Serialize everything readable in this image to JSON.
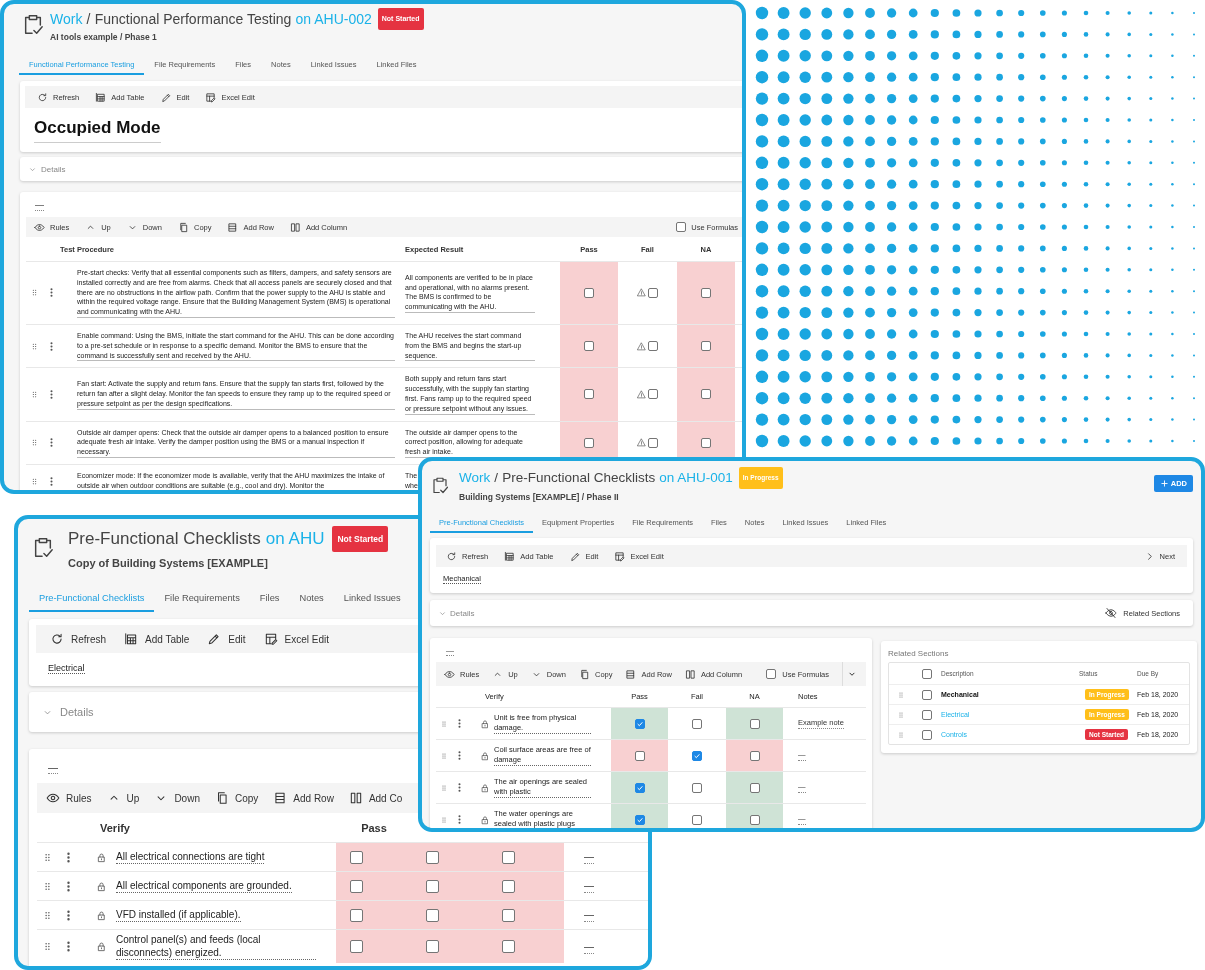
{
  "windows": [
    {
      "title": {
        "parent": "Work",
        "separator": "/",
        "name": "Functional Performance Testing",
        "target": "on AHU-002"
      },
      "badge": {
        "text": "Not Started",
        "kind": "danger"
      },
      "subtitle": "AI tools example / Phase 1",
      "tabs": [
        {
          "label": "Functional Performance Testing",
          "selected": true
        },
        {
          "label": "File Requirements",
          "selected": false
        },
        {
          "label": "Files",
          "selected": false
        },
        {
          "label": "Notes",
          "selected": false
        },
        {
          "label": "Linked Issues",
          "selected": false
        },
        {
          "label": "Linked Files",
          "selected": false
        }
      ],
      "toolbar": [
        {
          "kind": "refresh",
          "label": "Refresh"
        },
        {
          "kind": "table",
          "label": "Add Table"
        },
        {
          "kind": "pencil",
          "label": "Edit"
        },
        {
          "kind": "sheet",
          "label": "Excel Edit"
        }
      ],
      "section": {
        "text": "Occupied Mode",
        "kind": "heading"
      },
      "details": {
        "label": "Details"
      },
      "table": {
        "title": "—",
        "toolbar": [
          {
            "kind": "eye",
            "label": "Rules"
          },
          {
            "kind": "up",
            "label": "Up"
          },
          {
            "kind": "down",
            "label": "Down"
          },
          {
            "kind": "copy",
            "label": "Copy"
          },
          {
            "kind": "row",
            "label": "Add Row"
          },
          {
            "kind": "column",
            "label": "Add Column"
          }
        ],
        "use_formulas": {
          "label": "Use Formulas",
          "checked": false
        },
        "columns": [
          {
            "label": "Test Procedure",
            "kind": "text"
          },
          {
            "label": "Expected Result",
            "kind": "text"
          },
          {
            "label": "Pass",
            "kind": "check"
          },
          {
            "label": "Fail",
            "kind": "check"
          },
          {
            "label": "NA",
            "kind": "check"
          }
        ],
        "rows": [
          {
            "text": "Pre-start checks: Verify that all essential components such as filters, dampers, and safety sensors are installed correctly and are free from alarms. Check that all access panels are securely closed and that there are no obstructions in the airflow path. Confirm that the power supply to the AHU is stable and within the required voltage range. Ensure that the Building Management System (BMS) is operational and communicating with the AHU.",
            "expected": "All components are verified to be in place and operational, with no alarms present. The BMS is confirmed to be communicating with the AHU.",
            "checks": [
              {
                "checked": false,
                "kind": "error"
              },
              {
                "checked": false,
                "warning": true
              },
              {
                "checked": false,
                "kind": "error"
              }
            ]
          },
          {
            "text": "Enable command: Using the BMS, initiate the start command for the AHU. This can be done according to a pre-set schedule or in response to a specific demand. Monitor the BMS to ensure that the command is successfully sent and received by the AHU.",
            "expected": "The AHU receives the start command from the BMS and begins the start-up sequence.",
            "checks": [
              {
                "checked": false,
                "kind": "error"
              },
              {
                "checked": false,
                "warning": true
              },
              {
                "checked": false,
                "kind": "error"
              }
            ]
          },
          {
            "text": "Fan start: Activate the supply and return fans. Ensure that the supply fan starts first, followed by the return fan after a slight delay. Monitor the fan speeds to ensure they ramp up to the required speed or pressure setpoint as per the design specifications.",
            "expected": "Both supply and return fans start successfully, with the supply fan starting first. Fans ramp up to the required speed or pressure setpoint without any issues.",
            "checks": [
              {
                "checked": false,
                "kind": "error"
              },
              {
                "checked": false,
                "warning": true
              },
              {
                "checked": false,
                "kind": "error"
              }
            ]
          },
          {
            "text": "Outside air damper opens: Check that the outside air damper opens to a balanced position to ensure adequate fresh air intake. Verify the damper position using the BMS or a manual inspection if necessary.",
            "expected": "The outside air damper opens to the correct position, allowing for adequate fresh air intake.",
            "checks": [
              {
                "checked": false,
                "kind": "error"
              },
              {
                "checked": false,
                "warning": true
              },
              {
                "checked": false,
                "kind": "error"
              }
            ]
          },
          {
            "text": "Economizer mode: If the economizer mode is available, verify that the AHU maximizes the intake of outside air when outdoor conditions are suitable (e.g., cool and dry). Monitor the",
            "expected": "The\nwhe"
          }
        ]
      }
    },
    {
      "title": {
        "name": "Pre-Functional Checklists",
        "target": "on AHU"
      },
      "badge": {
        "text": "Not Started",
        "kind": "danger"
      },
      "subtitle": "Copy of Building Systems [EXAMPLE]",
      "tabs": [
        {
          "label": "Pre-Functional Checklists",
          "selected": true
        },
        {
          "label": "File Requirements",
          "selected": false
        },
        {
          "label": "Files",
          "selected": false
        },
        {
          "label": "Notes",
          "selected": false
        },
        {
          "label": "Linked Issues",
          "selected": false
        }
      ],
      "toolbar": [
        {
          "kind": "refresh",
          "label": "Refresh"
        },
        {
          "kind": "table",
          "label": "Add Table"
        },
        {
          "kind": "pencil",
          "label": "Edit"
        },
        {
          "kind": "sheet",
          "label": "Excel Edit"
        }
      ],
      "section": {
        "text": "Electrical",
        "kind": "label"
      },
      "details": {
        "label": "Details"
      },
      "table": {
        "title": "—",
        "toolbar": [
          {
            "kind": "eye",
            "label": "Rules"
          },
          {
            "kind": "up",
            "label": "Up"
          },
          {
            "kind": "down",
            "label": "Down"
          },
          {
            "kind": "copy",
            "label": "Copy"
          },
          {
            "kind": "row",
            "label": "Add Row"
          },
          {
            "kind": "column",
            "label": "Add Co"
          }
        ],
        "columns": [
          {
            "label": "Verify",
            "kind": "text"
          },
          {
            "label": "Pass",
            "kind": "check"
          }
        ],
        "rows": [
          {
            "locked": true,
            "text": "All electrical connections are tight",
            "checks": [
              {
                "checked": false,
                "kind": "error"
              },
              {
                "checked": false,
                "kind": "error"
              },
              {
                "checked": false,
                "kind": "error"
              }
            ],
            "notes": "—"
          },
          {
            "locked": true,
            "text": "All electrical components are grounded.",
            "checks": [
              {
                "checked": false,
                "kind": "error"
              },
              {
                "checked": false,
                "kind": "error"
              },
              {
                "checked": false,
                "kind": "error"
              }
            ],
            "notes": "—"
          },
          {
            "locked": true,
            "text": "VFD installed (if applicable).",
            "checks": [
              {
                "checked": false,
                "kind": "error"
              },
              {
                "checked": false,
                "kind": "error"
              },
              {
                "checked": false,
                "kind": "error"
              }
            ],
            "notes": "—"
          },
          {
            "locked": true,
            "text": "Control panel(s) and feeds (local disconnects) energized.",
            "checks": [
              {
                "checked": false,
                "kind": "error"
              },
              {
                "checked": false,
                "kind": "error"
              },
              {
                "checked": false,
                "kind": "error"
              }
            ],
            "notes": "—"
          }
        ]
      }
    },
    {
      "title": {
        "parent": "Work",
        "separator": "/",
        "name": "Pre-Functional Checklists",
        "target": "on AHU-001"
      },
      "badge": {
        "text": "In Progress",
        "kind": "warning"
      },
      "subtitle": "Building Systems [EXAMPLE] / Phase II",
      "add_button": {
        "label": "ADD"
      },
      "tabs": [
        {
          "label": "Pre-Functional Checklists",
          "selected": true
        },
        {
          "label": "Equipment Properties",
          "selected": false
        },
        {
          "label": "File Requirements",
          "selected": false
        },
        {
          "label": "Files",
          "selected": false
        },
        {
          "label": "Notes",
          "selected": false
        },
        {
          "label": "Linked Issues",
          "selected": false
        },
        {
          "label": "Linked Files",
          "selected": false
        }
      ],
      "toolbar": [
        {
          "kind": "refresh",
          "label": "Refresh"
        },
        {
          "kind": "table",
          "label": "Add Table"
        },
        {
          "kind": "pencil",
          "label": "Edit"
        },
        {
          "kind": "sheet",
          "label": "Excel Edit"
        }
      ],
      "next": {
        "label": "Next"
      },
      "section": {
        "text": "Mechanical",
        "kind": "label"
      },
      "details": {
        "label": "Details",
        "action": "Related Sections"
      },
      "table": {
        "title": "—",
        "toolbar": [
          {
            "kind": "eye",
            "label": "Rules"
          },
          {
            "kind": "up",
            "label": "Up"
          },
          {
            "kind": "down",
            "label": "Down"
          },
          {
            "kind": "copy",
            "label": "Copy"
          },
          {
            "kind": "row",
            "label": "Add Row"
          },
          {
            "kind": "column",
            "label": "Add Column"
          }
        ],
        "use_formulas": {
          "label": "Use Formulas",
          "checked": false
        },
        "dropdown": true,
        "columns": [
          {
            "label": "Verify",
            "kind": "text"
          },
          {
            "label": "Pass",
            "kind": "check"
          },
          {
            "label": "Fail",
            "kind": "check"
          },
          {
            "label": "NA",
            "kind": "check"
          },
          {
            "label": "Notes",
            "kind": "notes"
          }
        ],
        "rows": [
          {
            "locked": true,
            "text": "Unit is free from physical damage.",
            "checks": [
              {
                "checked": true,
                "kind": "ok"
              },
              {
                "checked": false
              },
              {
                "checked": false,
                "kind": "ok"
              }
            ],
            "notes": "Example note"
          },
          {
            "locked": true,
            "text": "Coil surface areas are free of damage",
            "checks": [
              {
                "checked": false,
                "kind": "error"
              },
              {
                "checked": true
              },
              {
                "checked": false,
                "kind": "error"
              }
            ],
            "notes": "—"
          },
          {
            "locked": true,
            "text": "The air openings are sealed with plastic",
            "checks": [
              {
                "checked": true,
                "kind": "ok"
              },
              {
                "checked": false
              },
              {
                "checked": false,
                "kind": "ok"
              }
            ],
            "notes": "—"
          },
          {
            "locked": true,
            "text": "The water openings are sealed with plastic plugs",
            "checks": [
              {
                "checked": true,
                "kind": "ok"
              },
              {
                "checked": false
              },
              {
                "checked": false,
                "kind": "ok"
              }
            ],
            "notes": "—"
          }
        ]
      },
      "related": {
        "title": "Related Sections",
        "all_checked": false,
        "columns": [
          "Description",
          "Status",
          "Due By"
        ],
        "rows": [
          {
            "description": "Mechanical",
            "current": true,
            "checked": false,
            "status": {
              "text": "In Progress",
              "kind": "warning"
            },
            "due": "Feb 18, 2020"
          },
          {
            "description": "Electrical",
            "current": false,
            "checked": false,
            "status": {
              "text": "In Progress",
              "kind": "warning"
            },
            "due": "Feb 18, 2020"
          },
          {
            "description": "Controls",
            "current": false,
            "checked": false,
            "status": {
              "text": "Not Started",
              "kind": "danger"
            },
            "due": "Feb 18, 2020"
          }
        ]
      }
    }
  ]
}
